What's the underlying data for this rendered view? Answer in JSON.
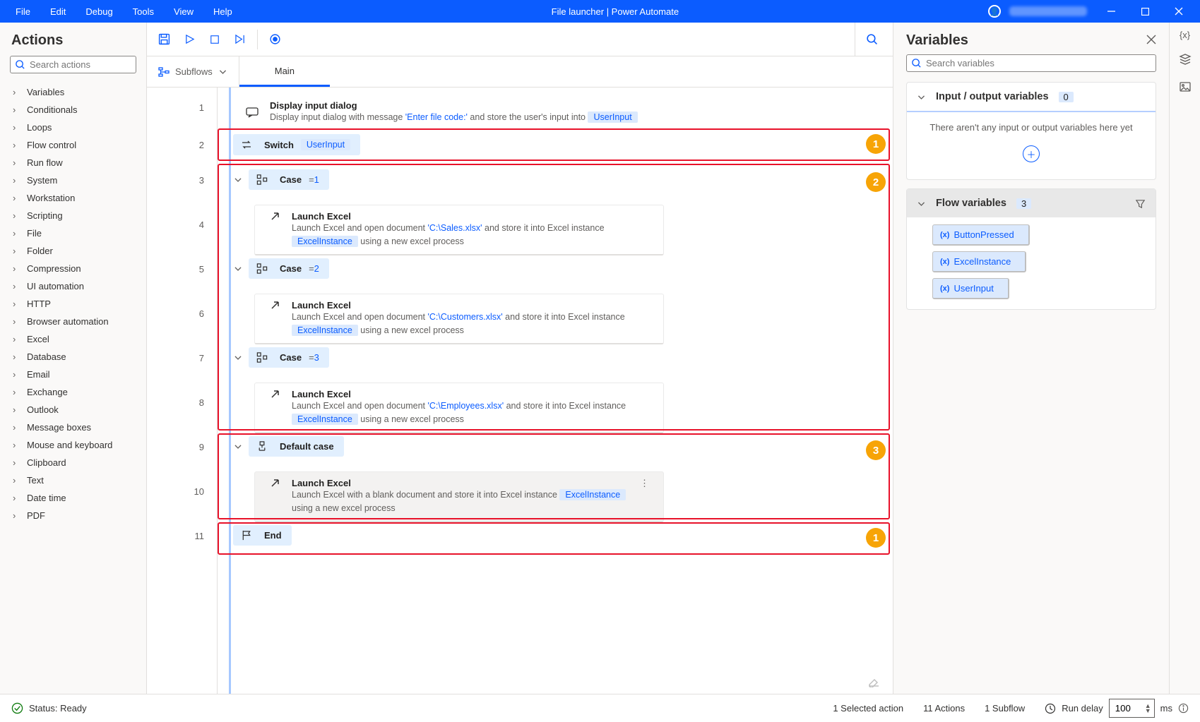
{
  "titlebar": {
    "menus": [
      "File",
      "Edit",
      "Debug",
      "Tools",
      "View",
      "Help"
    ],
    "title": "File launcher | Power Automate"
  },
  "actions": {
    "heading": "Actions",
    "search_placeholder": "Search actions",
    "tree": [
      "Variables",
      "Conditionals",
      "Loops",
      "Flow control",
      "Run flow",
      "System",
      "Workstation",
      "Scripting",
      "File",
      "Folder",
      "Compression",
      "UI automation",
      "HTTP",
      "Browser automation",
      "Excel",
      "Database",
      "Email",
      "Exchange",
      "Outlook",
      "Message boxes",
      "Mouse and keyboard",
      "Clipboard",
      "Text",
      "Date time",
      "PDF"
    ]
  },
  "subflows": {
    "label": "Subflows"
  },
  "tabs": {
    "main": "Main"
  },
  "flow": {
    "lines": [
      1,
      2,
      3,
      4,
      5,
      6,
      7,
      8,
      9,
      10,
      11
    ],
    "a1": {
      "title": "Display input dialog",
      "sub_a": "Display input dialog with message ",
      "msg": "'Enter file code:'",
      "sub_b": " and store the user's input into ",
      "var": "UserInput"
    },
    "a2": {
      "title": "Switch",
      "var": "UserInput"
    },
    "a3": {
      "title": "Case",
      "eq": "= ",
      "val": "1"
    },
    "a4": {
      "title": "Launch Excel",
      "sub_a": "Launch Excel and open document ",
      "path": "'C:\\Sales.xlsx'",
      "sub_b": " and store it into Excel instance",
      "var": "ExcelInstance",
      "sub_c": " using a new excel process"
    },
    "a5": {
      "title": "Case",
      "eq": "= ",
      "val": "2"
    },
    "a6": {
      "title": "Launch Excel",
      "sub_a": "Launch Excel and open document ",
      "path": "'C:\\Customers.xlsx'",
      "sub_b": " and store it into Excel instance",
      "var": "ExcelInstance",
      "sub_c": " using a new excel process"
    },
    "a7": {
      "title": "Case",
      "eq": "= ",
      "val": "3"
    },
    "a8": {
      "title": "Launch Excel",
      "sub_a": "Launch Excel and open document ",
      "path": "'C:\\Employees.xlsx'",
      "sub_b": " and store it into Excel instance",
      "var": "ExcelInstance",
      "sub_c": " using a new excel process"
    },
    "a9": {
      "title": "Default case"
    },
    "a10": {
      "title": "Launch Excel",
      "sub_a": "Launch Excel with a blank document and store it into Excel instance ",
      "var": "ExcelInstance",
      "sub_b": " using a new excel process"
    },
    "a11": {
      "title": "End"
    }
  },
  "vars": {
    "heading": "Variables",
    "search_placeholder": "Search variables",
    "io_title": "Input / output variables",
    "io_count": "0",
    "io_empty": "There aren't any input or output variables here yet",
    "flow_title": "Flow variables",
    "flow_count": "3",
    "flow_vars": [
      "ButtonPressed",
      "ExcelInstance",
      "UserInput"
    ]
  },
  "status": {
    "ready": "Status: Ready",
    "selected": "1 Selected action",
    "count": "11 Actions",
    "subflows": "1 Subflow",
    "rundelay": "Run delay",
    "delayval": "100",
    "ms": "ms"
  },
  "annotations": {
    "b1": "1",
    "b2": "2",
    "b3": "3"
  }
}
